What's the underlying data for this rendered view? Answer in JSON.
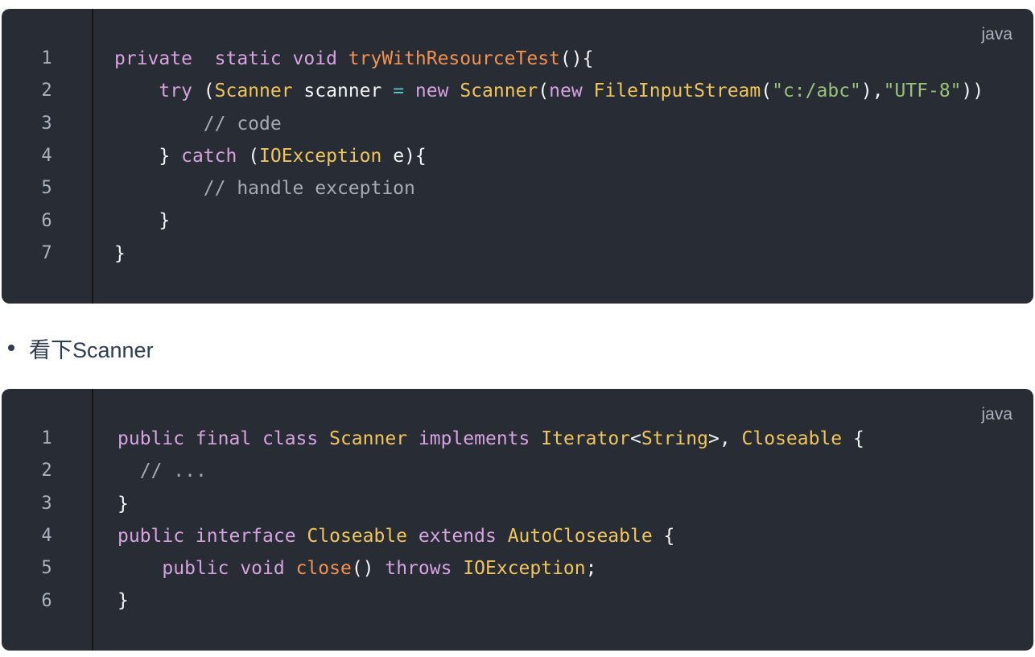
{
  "block1": {
    "language": "java",
    "line_numbers": [
      "1",
      "2",
      "3",
      "4",
      "5",
      "6",
      "7"
    ],
    "lines": [
      [
        [
          "kw",
          "private  static void "
        ],
        [
          "fn",
          "tryWithResourceTest"
        ],
        [
          "pl",
          "(){"
        ]
      ],
      [
        [
          "pl",
          "    "
        ],
        [
          "kw",
          "try"
        ],
        [
          "pl",
          " ("
        ],
        [
          "cls",
          "Scanner"
        ],
        [
          "pl",
          " scanner "
        ],
        [
          "op",
          "="
        ],
        [
          "pl",
          " "
        ],
        [
          "kw",
          "new"
        ],
        [
          "pl",
          " "
        ],
        [
          "cls",
          "Scanner"
        ],
        [
          "pl",
          "("
        ],
        [
          "kw",
          "new"
        ],
        [
          "pl",
          " "
        ],
        [
          "cls",
          "FileInputStream"
        ],
        [
          "pl",
          "("
        ],
        [
          "str",
          "\"c:/abc\""
        ],
        [
          "pl",
          "),"
        ],
        [
          "str",
          "\"UTF-8\""
        ],
        [
          "pl",
          "))"
        ]
      ],
      [
        [
          "pl",
          "        "
        ],
        [
          "cm",
          "// code"
        ]
      ],
      [
        [
          "pl",
          "    } "
        ],
        [
          "kw",
          "catch"
        ],
        [
          "pl",
          " ("
        ],
        [
          "cls",
          "IOException"
        ],
        [
          "pl",
          " e){"
        ]
      ],
      [
        [
          "pl",
          "        "
        ],
        [
          "cm",
          "// handle exception"
        ]
      ],
      [
        [
          "pl",
          "    }"
        ]
      ],
      [
        [
          "pl",
          "}"
        ]
      ]
    ]
  },
  "bullet": {
    "text": "看下Scanner"
  },
  "block2": {
    "language": "java",
    "line_numbers": [
      "1",
      "2",
      "3",
      "4",
      "5",
      "6"
    ],
    "lines": [
      [
        [
          "kw",
          "public final class "
        ],
        [
          "cls",
          "Scanner"
        ],
        [
          "pl",
          " "
        ],
        [
          "kw",
          "implements"
        ],
        [
          "pl",
          " "
        ],
        [
          "cls",
          "Iterator"
        ],
        [
          "pl",
          "<"
        ],
        [
          "cls",
          "String"
        ],
        [
          "pl",
          ">, "
        ],
        [
          "cls",
          "Closeable"
        ],
        [
          "pl",
          " {"
        ]
      ],
      [
        [
          "pl",
          "  "
        ],
        [
          "cm",
          "// ..."
        ]
      ],
      [
        [
          "pl",
          "}"
        ]
      ],
      [
        [
          "kw",
          "public interface "
        ],
        [
          "cls",
          "Closeable"
        ],
        [
          "pl",
          " "
        ],
        [
          "kw",
          "extends"
        ],
        [
          "pl",
          " "
        ],
        [
          "cls",
          "AutoCloseable"
        ],
        [
          "pl",
          " {"
        ]
      ],
      [
        [
          "pl",
          "    "
        ],
        [
          "kw",
          "public void "
        ],
        [
          "fn",
          "close"
        ],
        [
          "pl",
          "() "
        ],
        [
          "kw",
          "throws"
        ],
        [
          "pl",
          " "
        ],
        [
          "cls",
          "IOException"
        ],
        [
          "pl",
          ";"
        ]
      ],
      [
        [
          "pl",
          "}"
        ]
      ]
    ]
  }
}
